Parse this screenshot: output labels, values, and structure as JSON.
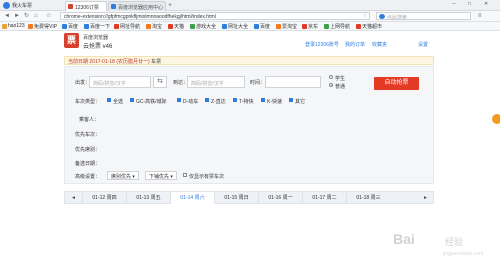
{
  "browser": {
    "window_title": "我火车票",
    "tabs": [
      {
        "label": "12306订票",
        "active": true
      },
      {
        "label": "百度浏览器应用中心",
        "active": false
      }
    ],
    "new_tab": "+",
    "url": "chrome-extension://gfpfmcgpnkfljmiolmnnaoodfhekgj/html/index.html",
    "search_placeholder": "点此搜索",
    "bookmarks": [
      "hao123",
      "免费得VIP",
      "百度",
      "百度一下",
      "网址导航",
      "淘宝",
      "天猫",
      "游戏大全",
      "网址大全",
      "百度",
      "爱淘宝",
      "京东",
      "上网导航",
      "天猫超市"
    ]
  },
  "app": {
    "logo_char": "票",
    "name": "百度浏览器",
    "version": "云抢票 v46",
    "top_links": [
      "登录12306账号",
      "我的订单",
      "收藏夹",
      "设置"
    ],
    "notice": {
      "date": "当前日期 2017-01-18 (农历腊月廿一)",
      "suffix": "车票"
    }
  },
  "form": {
    "from_label": "出发：",
    "from_placeholder": "简码/拼音/汉字",
    "swap_icon": "⇆",
    "to_label": "到达：",
    "to_placeholder": "简码/拼音/汉字",
    "time_label": "时间：",
    "time_placeholder": "",
    "ticket_type": [
      {
        "label": "学生",
        "selected": false
      },
      {
        "label": "普通",
        "selected": true
      }
    ],
    "query_button": "自动抢票",
    "train_type_label": "车次类型：",
    "train_types": [
      {
        "label": "全选",
        "checked": true
      },
      {
        "label": "GC-高铁/城际",
        "checked": true
      },
      {
        "label": "D-动车",
        "checked": true
      },
      {
        "label": "Z-直达",
        "checked": true
      },
      {
        "label": "T-特快",
        "checked": true
      },
      {
        "label": "K-快速",
        "checked": true
      },
      {
        "label": "其它",
        "checked": true
      }
    ],
    "passenger_label": "乘客人：",
    "prefer_train_label": "优先车次：",
    "prefer_seat_label": "优先席别：",
    "backup_date_label": "备选日期：",
    "advanced_label": "高级设置：",
    "sort_select": "席别优先",
    "type_select": "下铺优先",
    "partial_submit": "仅显示有票车次"
  },
  "date_tabs": {
    "prev": "◄",
    "next": "►",
    "dates": [
      {
        "label": "01-12 周四",
        "active": false
      },
      {
        "label": "01-13 周五",
        "active": false
      },
      {
        "label": "01-14 周六",
        "active": true
      },
      {
        "label": "01-15 周日",
        "active": false
      },
      {
        "label": "01-16 周一",
        "active": false
      },
      {
        "label": "01-17 周二",
        "active": false
      },
      {
        "label": "01-18 周三",
        "active": false
      }
    ]
  },
  "watermark": {
    "brand": "Bai",
    "sub": "经验",
    "url": "jingyan.baidu.com"
  },
  "colors": {
    "accent": "#2f7de1",
    "danger": "#e23a24",
    "notice_bg": "#fdf7e2"
  }
}
